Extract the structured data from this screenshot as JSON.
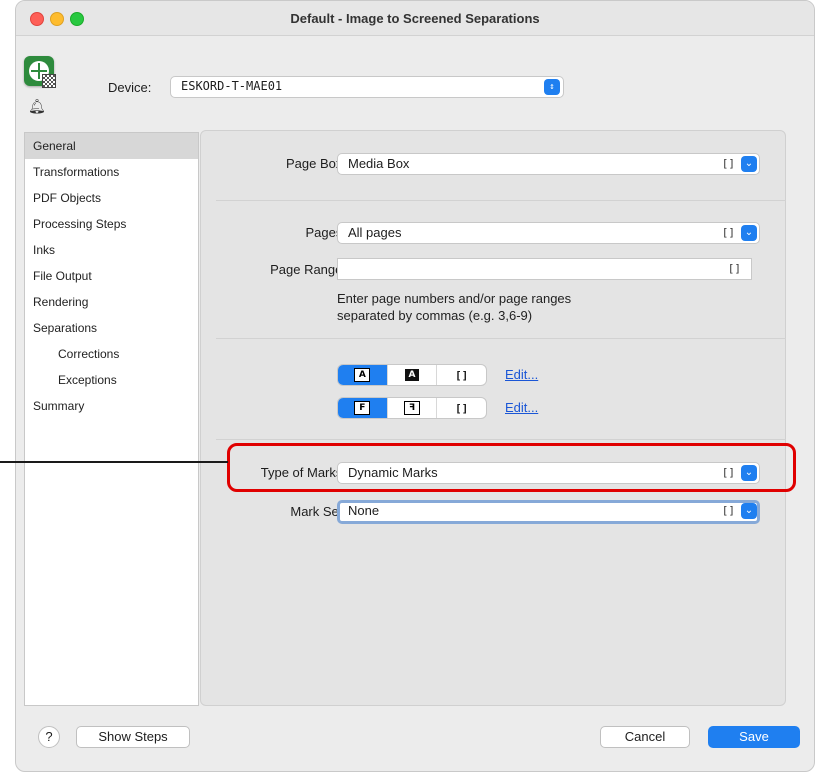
{
  "window": {
    "title": "Default - Image to Screened Separations"
  },
  "device": {
    "label": "Device:",
    "value": "ESKORD-T-MAE01",
    "stepper_icon": "updown-stepper-icon"
  },
  "sidebar": {
    "items": [
      {
        "label": "General",
        "selected": true,
        "sub": false
      },
      {
        "label": "Transformations",
        "sub": false
      },
      {
        "label": "PDF Objects",
        "sub": false
      },
      {
        "label": "Processing Steps",
        "sub": false
      },
      {
        "label": "Inks",
        "sub": false
      },
      {
        "label": "File Output",
        "sub": false
      },
      {
        "label": "Rendering",
        "sub": false
      },
      {
        "label": "Separations",
        "sub": false
      },
      {
        "label": "Corrections",
        "sub": true
      },
      {
        "label": "Exceptions",
        "sub": true
      },
      {
        "label": "Summary",
        "sub": false
      }
    ]
  },
  "form": {
    "page_box": {
      "label": "Page Box:",
      "value": "Media Box"
    },
    "pages": {
      "label": "Pages:",
      "value": "All pages"
    },
    "page_range": {
      "label": "Page Range:",
      "value": ""
    },
    "hint_line1": "Enter page numbers and/or page ranges",
    "hint_line2": "separated by commas (e.g. 3,6-9)",
    "seg1": {
      "a": "A",
      "b": "A",
      "c": "[]",
      "link": "Edit..."
    },
    "seg2": {
      "a": "F",
      "b": "F",
      "c": "[]",
      "link": "Edit..."
    },
    "type_of_marks": {
      "label": "Type of Marks:",
      "value": "Dynamic Marks"
    },
    "mark_set": {
      "label": "Mark Set:",
      "value": "None"
    },
    "bracket": "[]"
  },
  "footer": {
    "help": "?",
    "show_steps": "Show Steps",
    "cancel": "Cancel",
    "save": "Save"
  },
  "colors": {
    "accent": "#1f7ff0",
    "highlight": "#e00000"
  }
}
